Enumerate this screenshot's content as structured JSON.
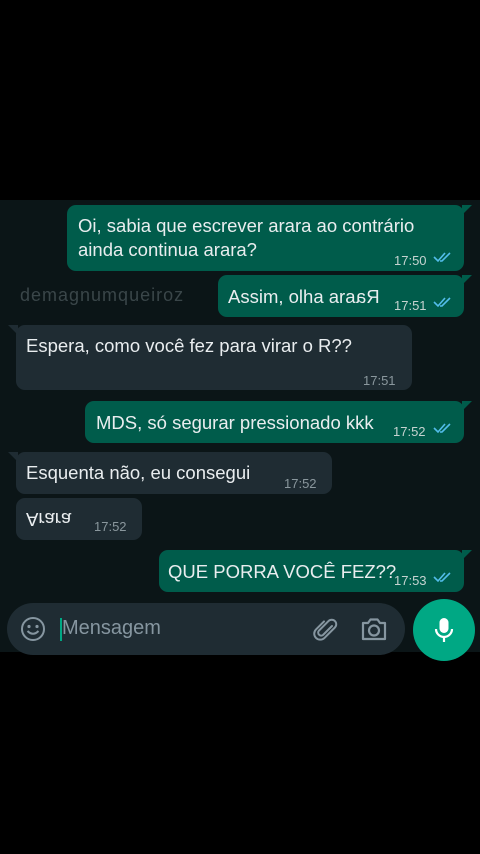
{
  "watermark": "demagnumqueiroz",
  "messages": [
    {
      "direction": "outgoing",
      "lines": [
        "Oi, sabia que escrever arara ao contrário",
        "ainda continua arara?"
      ],
      "time": "17:50",
      "status": "read"
    },
    {
      "direction": "outgoing",
      "text_prefix": "Assim, olha ara",
      "text_suffix": "Ra",
      "suffix_style": "mirrored",
      "time": "17:51",
      "status": "read"
    },
    {
      "direction": "incoming",
      "text": "Espera, como você fez para virar o R??",
      "time": "17:51"
    },
    {
      "direction": "outgoing",
      "text": "MDS, só segurar pressionado kkk",
      "time": "17:52",
      "status": "read"
    },
    {
      "direction": "incoming",
      "text": "Esquenta não, eu consegui",
      "time": "17:52"
    },
    {
      "direction": "incoming",
      "text": "Arara",
      "text_style": "upside-down",
      "time": "17:52"
    },
    {
      "direction": "outgoing",
      "text": "QUE PORRA VOCÊ FEZ??",
      "time": "17:53",
      "status": "read"
    }
  ],
  "composer": {
    "placeholder": "Mensagem",
    "emoji_icon": "emoji-icon",
    "attach_icon": "paperclip-icon",
    "camera_icon": "camera-icon",
    "mic_icon": "mic-icon"
  },
  "colors": {
    "chat_bg": "#0b1517",
    "outgoing_bubble": "#005c4b",
    "incoming_bubble": "#1f2c33",
    "read_ticks": "#53bdeb",
    "accent": "#00a884"
  }
}
